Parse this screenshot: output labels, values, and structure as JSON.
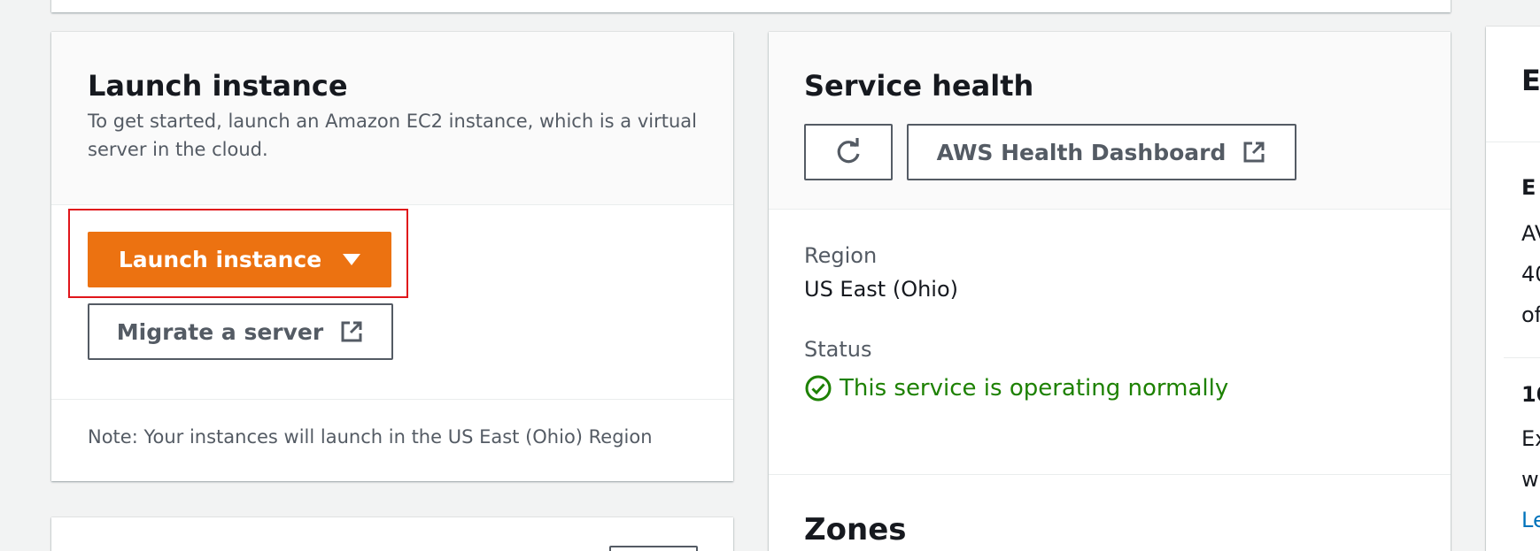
{
  "launch": {
    "title": "Launch instance",
    "description": "To get started, launch an Amazon EC2 instance, which is a virtual server in the cloud.",
    "launch_button_label": "Launch instance",
    "migrate_button_label": "Migrate a server",
    "note": "Note: Your instances will launch in the US East (Ohio) Region"
  },
  "health": {
    "title": "Service health",
    "dashboard_button_label": "AWS Health Dashboard",
    "region_label": "Region",
    "region_value": "US East (Ohio)",
    "status_label": "Status",
    "status_value": "This service is operating normally",
    "zones_title": "Zones"
  },
  "right_panel": {
    "title_fragment": "E",
    "section_title_fragment": "E",
    "line1": "AV",
    "line2": "40",
    "line3": "of",
    "section2_title_fragment": "10",
    "line4": "Ex",
    "line5": "w",
    "link_fragment": "Le"
  },
  "colors": {
    "primary": "#ec7211",
    "success": "#1d8102",
    "highlight": "#e0161b",
    "link": "#0073bb"
  },
  "icons": {
    "launch_caret": "caret-down-icon",
    "migrate_external": "external-link-icon",
    "refresh": "refresh-icon",
    "dashboard_external": "external-link-icon",
    "status": "check-circle-icon"
  }
}
